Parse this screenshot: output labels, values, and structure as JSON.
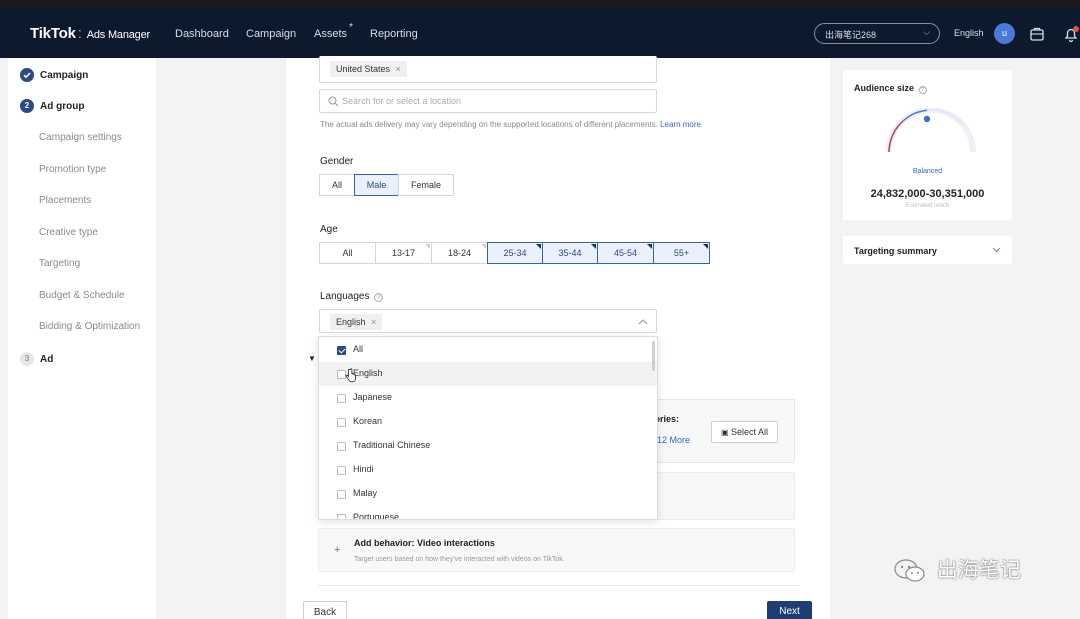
{
  "header": {
    "brand": "TikTok",
    "brand_sub": "Ads Manager",
    "nav": [
      "Dashboard",
      "Campaign",
      "Assets",
      "Reporting"
    ],
    "account": "出海笔记268",
    "language": "English",
    "avatar_letter": "u"
  },
  "sidebar": {
    "steps": [
      {
        "label": "Campaign",
        "marker": "✓"
      },
      {
        "label": "Ad group",
        "marker": "2"
      },
      {
        "label": "Ad",
        "marker": "3"
      }
    ],
    "substeps": [
      "Campaign settings",
      "Promotion type",
      "Placements",
      "Creative type",
      "Targeting",
      "Budget & Schedule",
      "Bidding & Optimization"
    ]
  },
  "location": {
    "selected_tag": "United States",
    "search_placeholder": "Search for or select a location",
    "hint": "The actual ads delivery may vary depending on the supported locations of different placements.",
    "learn_more": "Learn more"
  },
  "gender": {
    "label": "Gender",
    "options": [
      "All",
      "Male",
      "Female"
    ],
    "selected": "Male"
  },
  "age": {
    "label": "Age",
    "options": [
      "All",
      "13-17",
      "18-24",
      "25-34",
      "35-44",
      "45-54",
      "55+"
    ],
    "selected": [
      "25-34",
      "35-44",
      "45-54",
      "55+"
    ]
  },
  "languages": {
    "label": "Languages",
    "selected_tag": "English",
    "options": [
      {
        "label": "All",
        "checked": true
      },
      {
        "label": "English",
        "checked": false
      },
      {
        "label": "Japanese",
        "checked": false
      },
      {
        "label": "Korean",
        "checked": false
      },
      {
        "label": "Traditional Chinese",
        "checked": false
      },
      {
        "label": "Hindi",
        "checked": false
      },
      {
        "label": "Malay",
        "checked": false
      },
      {
        "label": "Portuguese",
        "checked": false
      }
    ]
  },
  "interests": {
    "categories_label": "gories:",
    "more_link": "12 More",
    "select_all": "Select All"
  },
  "behavior": {
    "title": "Add behavior: Video interactions",
    "desc": "Target users based on how they've interacted with videos on TikTok."
  },
  "audience": {
    "title": "Audience size",
    "status": "Balanced",
    "range": "24,832,000-30,351,000",
    "caption": "Estimated reach"
  },
  "targeting_summary": "Targeting summary",
  "footer": {
    "back": "Back",
    "next": "Next"
  },
  "watermark": "出海笔记",
  "colors": {
    "navbar": "#0d1a2e",
    "accent": "#2b4a86",
    "link": "#2f63c9"
  }
}
